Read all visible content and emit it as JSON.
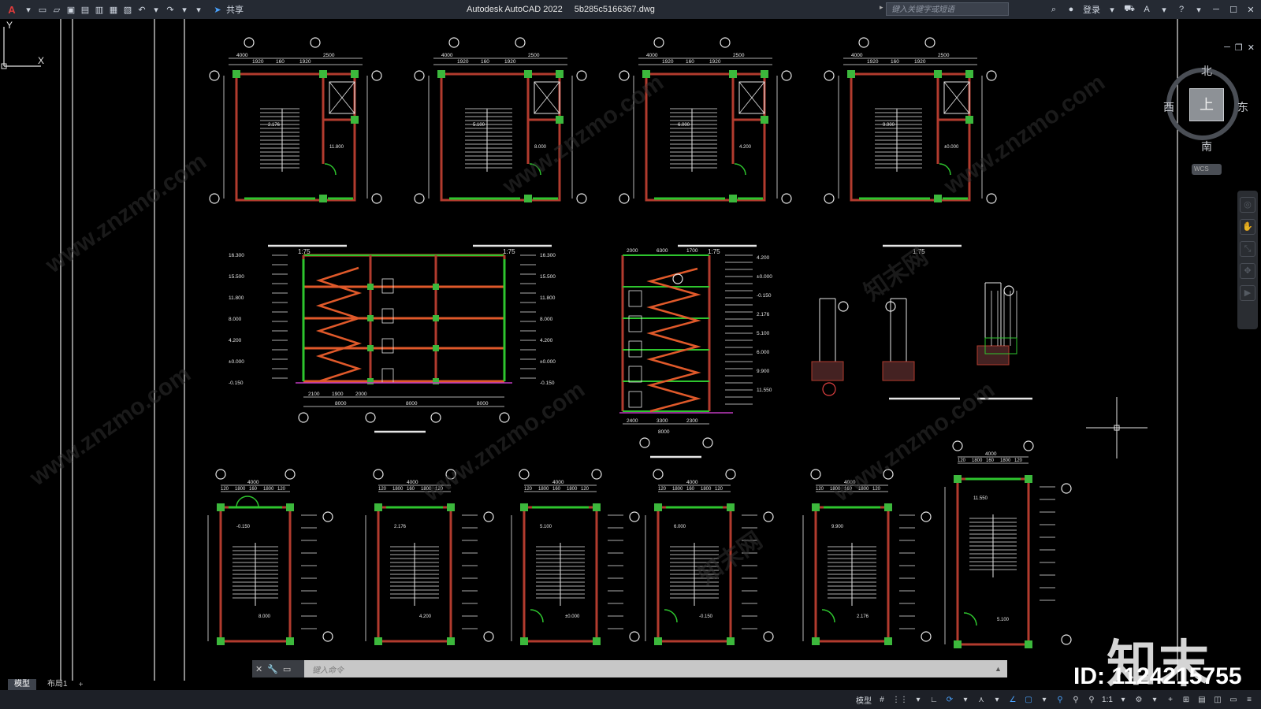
{
  "titlebar": {
    "app_logo": "A",
    "share_label": "共享",
    "app_name": "Autodesk AutoCAD 2022",
    "file_name": "5b285c5166367.dwg",
    "search_placeholder": "键入关键字或短语",
    "login_label": "登录",
    "help_label": "?"
  },
  "viewcube": {
    "north": "北",
    "south": "南",
    "east": "东",
    "west": "西",
    "face": "上",
    "wcs_label": "WCS"
  },
  "drawing": {
    "scale_labels": [
      "1:75",
      "1:75",
      "1:75",
      "1:75"
    ],
    "dims_top": [
      "4000",
      "1920",
      "160",
      "1920",
      "2500"
    ],
    "dims_bottom": [
      "4000",
      "120",
      "1800",
      "160",
      "1800",
      "120"
    ],
    "elevations": [
      "16.300",
      "15.500",
      "11.800",
      "8.000",
      "4.200",
      "±0.000",
      "-0.150",
      "2.176",
      "5.100",
      "6.000",
      "9.900",
      "11.550"
    ],
    "section_dims": [
      "2100",
      "1900",
      "2000",
      "8000",
      "8000",
      "8000"
    ],
    "section2_dims": [
      "2000",
      "6300",
      "1700",
      "2400",
      "3300",
      "2300",
      "8000"
    ],
    "ucs_y": "Y",
    "ucs_x": "X"
  },
  "commandline": {
    "placeholder": "键入命令"
  },
  "layout_tabs": [
    "模型",
    "布局1"
  ],
  "statusbar": {
    "model_label": "模型",
    "scale_label": "1:1"
  },
  "watermark": {
    "brand": "知末",
    "image_id": "ID: 1124215755",
    "site": "www.znzmo.com",
    "site_cn": "知末网"
  },
  "colors": {
    "wall_red": "#b23b2e",
    "green": "#2ec52e",
    "column_green": "#3cb83c",
    "orange": "#e0592a",
    "white": "#e6e6e6",
    "magenta": "#c03ac0"
  }
}
